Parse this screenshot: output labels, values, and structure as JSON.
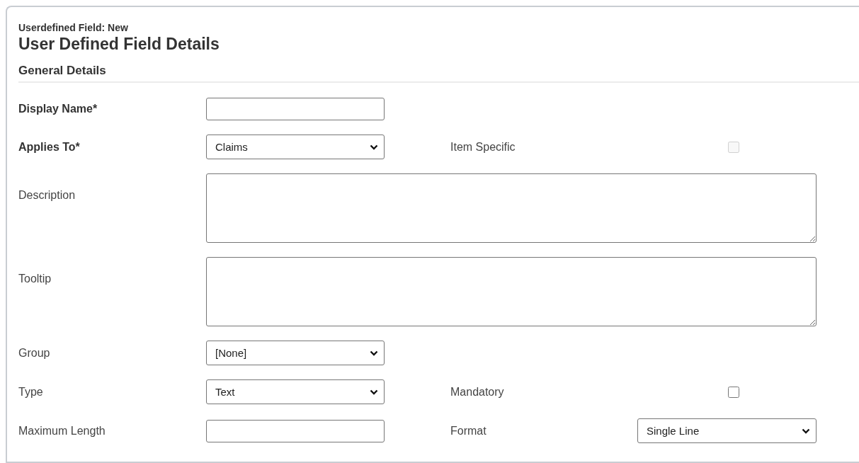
{
  "header": {
    "breadcrumb": "Userdefined Field: New",
    "title": "User Defined Field Details"
  },
  "section": {
    "title": "General Details"
  },
  "rows": [
    {
      "fields": [
        {
          "label": "Display Name*",
          "required": true,
          "control": {
            "kind": "text"
          }
        }
      ]
    },
    {
      "fields": [
        {
          "label": "Applies To*",
          "required": true,
          "control": {
            "kind": "select",
            "value": "Claims"
          }
        },
        {
          "label": "Item Specific",
          "required": false,
          "control": {
            "kind": "checkbox",
            "checked": false,
            "disabled": true
          }
        }
      ]
    },
    {
      "fields": [
        {
          "label": "Description",
          "required": false,
          "control": {
            "kind": "textarea"
          }
        }
      ]
    },
    {
      "fields": [
        {
          "label": "Tooltip",
          "required": false,
          "control": {
            "kind": "textarea"
          }
        }
      ]
    },
    {
      "fields": [
        {
          "label": "Group",
          "required": false,
          "control": {
            "kind": "select",
            "value": "[None]"
          }
        }
      ]
    },
    {
      "fields": [
        {
          "label": "Type",
          "required": false,
          "control": {
            "kind": "select",
            "value": "Text"
          }
        },
        {
          "label": "Mandatory",
          "required": false,
          "control": {
            "kind": "checkbox",
            "checked": false,
            "disabled": false
          }
        }
      ]
    },
    {
      "fields": [
        {
          "label": "Maximum Length",
          "required": false,
          "control": {
            "kind": "text"
          }
        },
        {
          "label": "Format",
          "required": false,
          "control": {
            "kind": "select",
            "value": "Single Line"
          }
        }
      ]
    }
  ]
}
